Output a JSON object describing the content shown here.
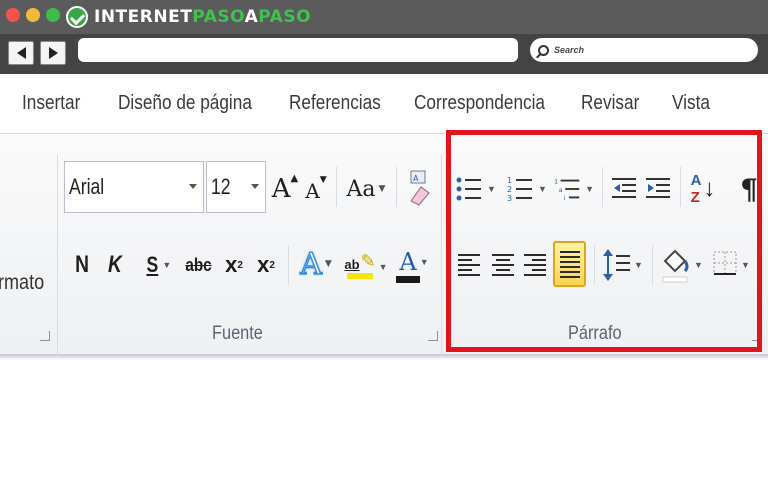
{
  "window": {
    "brand": {
      "part1": "INTERNET",
      "part2": "PASO",
      "part3": "A",
      "part4": "PASO"
    },
    "search_placeholder": "Search"
  },
  "tabs": [
    "Insertar",
    "Diseño de página",
    "Referencias",
    "Correspondencia",
    "Revisar",
    "Vista"
  ],
  "groups": {
    "left_partial_label": "rmato",
    "fuente": {
      "label": "Fuente",
      "font_name": "Arial",
      "font_size": "12",
      "grow_label": "A",
      "shrink_label": "A",
      "case_label": "Aa",
      "bold": "N",
      "italic": "K",
      "underline": "S",
      "strike": "abc",
      "subscript": "x",
      "subscript_mark": "2",
      "superscript": "x",
      "superscript_mark": "2",
      "effects_label": "A",
      "highlight_label": "ab",
      "color_label": "A"
    },
    "parrafo": {
      "label": "Párrafo",
      "sort_top": "A",
      "sort_bottom": "Z",
      "pilcrow": "¶"
    }
  },
  "colors": {
    "highlight_rect": "#e3141c",
    "brand_green": "#3fc14f",
    "font_color_bar": "#1a1a1a",
    "highlight_color_bar": "#f4e40c",
    "effects_blue": "#3b8fd9"
  }
}
